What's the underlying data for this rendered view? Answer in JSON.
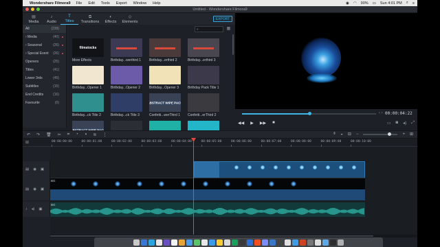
{
  "menubar": {
    "app_name": "Wondershare Filmora9",
    "items": [
      "File",
      "Edit",
      "Tools",
      "Export",
      "Window",
      "Help"
    ],
    "battery": "90%",
    "clock": "Sun 4:01 PM"
  },
  "window": {
    "title": "Untitled - Wondershare Filmora9"
  },
  "tabs": [
    {
      "label": "Media",
      "icon": "folder-icon"
    },
    {
      "label": "Audio",
      "icon": "music-note-icon"
    },
    {
      "label": "Titles",
      "icon": "text-icon"
    },
    {
      "label": "Transitions",
      "icon": "transition-icon"
    },
    {
      "label": "Effects",
      "icon": "effects-icon"
    },
    {
      "label": "Elements",
      "icon": "elements-icon"
    }
  ],
  "active_tab": "Titles",
  "export_label": "EXPORT",
  "categories": [
    {
      "label": "All",
      "count": "(239)"
    },
    {
      "label": "› Media",
      "count": "(40)",
      "dot": true
    },
    {
      "label": "› Seasonal",
      "count": "(26)",
      "dot": true
    },
    {
      "label": "› Special Event",
      "count": "(26)",
      "dot": true
    },
    {
      "label": "Openers",
      "count": "(25)"
    },
    {
      "label": "Titles",
      "count": "(41)"
    },
    {
      "label": "Lower 3rds",
      "count": "(45)"
    },
    {
      "label": "Subtitles",
      "count": "(15)"
    },
    {
      "label": "End Credits",
      "count": "(16)"
    },
    {
      "label": "Favourite",
      "count": "(0)"
    }
  ],
  "grid_items": [
    {
      "label": "More Effects",
      "thumb_text": "filmstocks",
      "color": "#111317"
    },
    {
      "label": "Birthday...werthird 1",
      "thumb_text": "",
      "color": "#3b3a52"
    },
    {
      "label": "Birthday...erthird 2",
      "thumb_text": "",
      "color": "#4a3a3a"
    },
    {
      "label": "Birthday...erthird 3",
      "thumb_text": "",
      "color": "#4a4650"
    },
    {
      "label": "Birthday...Opener 1",
      "thumb_text": "",
      "color": "#f1e6cf"
    },
    {
      "label": "Birthday...Opener 2",
      "thumb_text": "",
      "color": "#6b5ba8"
    },
    {
      "label": "Birthday...Opener 3",
      "thumb_text": "",
      "color": "#f2e2b8"
    },
    {
      "label": "Birthday Pack Title 1",
      "thumb_text": "",
      "color": "#3c3a4a"
    },
    {
      "label": "Birthday...ck Title 2",
      "thumb_text": "",
      "color": "#2f8f8f"
    },
    {
      "label": "Birthday...ck Title 3",
      "thumb_text": "",
      "color": "#2f3e66"
    },
    {
      "label": "Confetti...werThird 1",
      "thumb_text": "ABSTRACT WIPE PACK",
      "color": "#3a4356"
    },
    {
      "label": "Confetti...erThird 2",
      "thumb_text": "",
      "color": "#3b3a3e"
    },
    {
      "label": "",
      "thumb_text": "ABSTRACT WIPE PACK",
      "color": "#3a4356"
    },
    {
      "label": "",
      "thumb_text": "",
      "color": "#2b2f35"
    },
    {
      "label": "",
      "thumb_text": "",
      "color": "#1fb0a6"
    },
    {
      "label": "",
      "thumb_text": "",
      "color": "#23b6c8"
    }
  ],
  "search_placeholder": "",
  "preview": {
    "timecode": "00:00:04:22",
    "progress_percent": 50
  },
  "ruler_ticks": [
    "00:00:00:00",
    "00:00:01:00",
    "00:00:02:00",
    "00:00:03:00",
    "00:00:04:00",
    "00:00:05:00",
    "00:00:06:00",
    "00:00:07:00",
    "00:00:08:00",
    "00:00:09:00",
    "00:00:10:00"
  ],
  "tracks": {
    "video_label": "BG",
    "audio_label": "BG"
  },
  "colors": {
    "accent": "#3fb6e6",
    "playhead": "#e0483e",
    "title_clip": "#1c4f7c",
    "audio_clip": "#123a3a"
  }
}
